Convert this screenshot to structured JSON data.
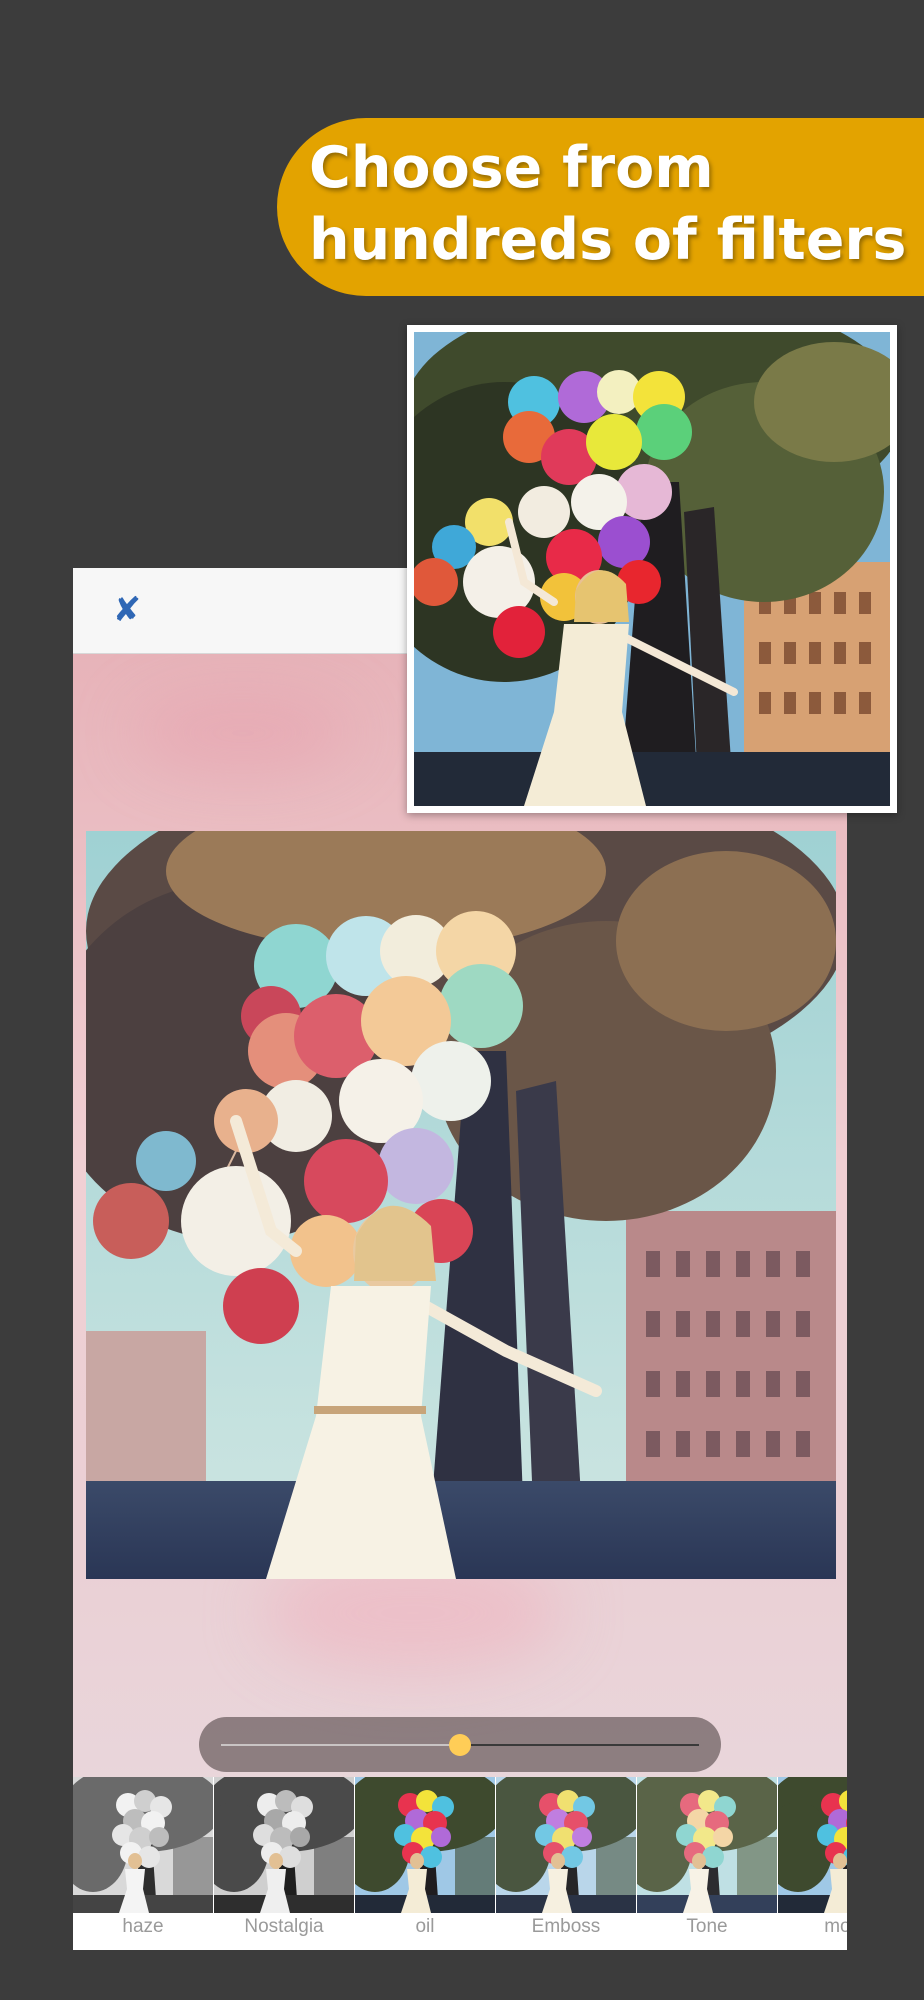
{
  "banner": {
    "line1": "Choose from",
    "line2": "hundreds of filters"
  },
  "toolbar": {
    "close_icon": "close-icon",
    "close_glyph": "✘"
  },
  "slider": {
    "value": 0.5
  },
  "filters": [
    {
      "label": "haze",
      "style": "gray"
    },
    {
      "label": "Nostalgia",
      "style": "gray-dark"
    },
    {
      "label": "oil",
      "style": "color"
    },
    {
      "label": "Emboss",
      "style": "color-cool"
    },
    {
      "label": "Tone",
      "style": "color-soft"
    },
    {
      "label": "mono",
      "style": "color"
    }
  ],
  "colors": {
    "banner": "#e3a300",
    "background": "#3c3c3c",
    "accent": "#ffcd57"
  }
}
